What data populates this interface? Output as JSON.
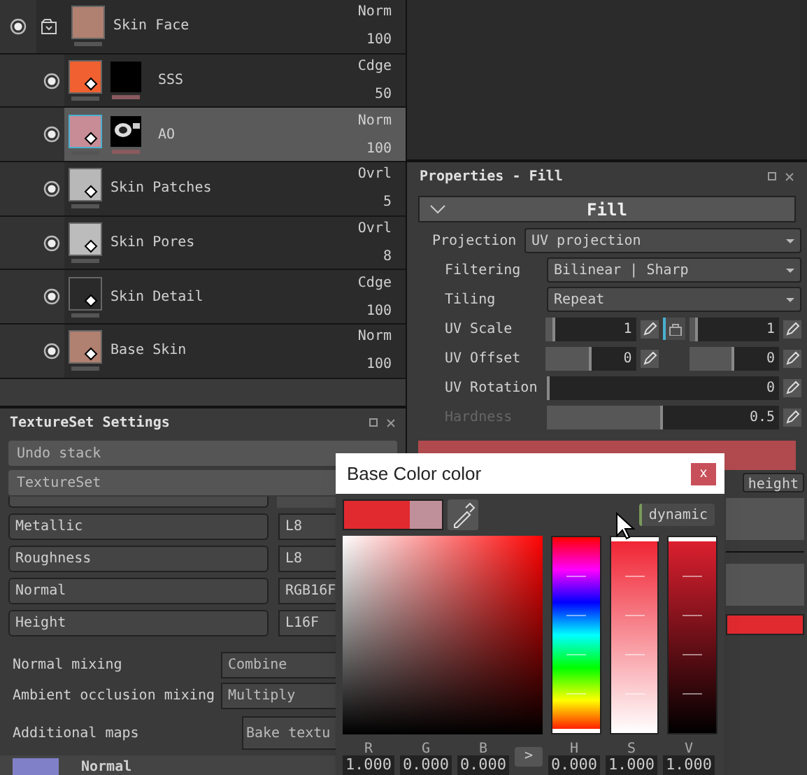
{
  "layers": [
    {
      "kind": "folder",
      "name": "Skin Face",
      "blend": "Norm",
      "opacity": "100",
      "visible": true,
      "selected": false,
      "color": "#b08070",
      "children": [
        {
          "kind": "fill",
          "name": "SSS",
          "blend": "Cdge",
          "opacity": "50",
          "visible": true,
          "selected": false,
          "color": "#f06030",
          "mask": {
            "kind": "black"
          }
        },
        {
          "kind": "fill",
          "name": "AO",
          "blend": "Norm",
          "opacity": "100",
          "visible": true,
          "selected": true,
          "color": "#c88c96",
          "mask": {
            "kind": "ao"
          }
        },
        {
          "kind": "fill",
          "name": "Skin Patches",
          "blend": "Ovrl",
          "opacity": "5",
          "visible": true,
          "selected": false,
          "color": "#b8b8b8"
        },
        {
          "kind": "fill",
          "name": "Skin Pores",
          "blend": "Ovrl",
          "opacity": "8",
          "visible": true,
          "selected": false,
          "color": "#bcbcbc"
        },
        {
          "kind": "fill",
          "name": "Skin Detail",
          "blend": "Cdge",
          "opacity": "100",
          "visible": true,
          "selected": false,
          "color": "#2a2a2a"
        },
        {
          "kind": "fill",
          "name": "Base Skin",
          "blend": "Norm",
          "opacity": "100",
          "visible": true,
          "selected": false,
          "color": "#b08070"
        }
      ]
    }
  ],
  "properties": {
    "title": "Properties - Fill",
    "section": {
      "title": "Fill",
      "expanded": true
    },
    "rows": [
      {
        "kind": "dropdown",
        "label": "Projection",
        "value": "UV projection",
        "children": [
          {
            "kind": "dropdown",
            "label": "Filtering",
            "value": "Bilinear | Sharp",
            "disabled": false
          },
          {
            "kind": "dropdown",
            "label": "Tiling",
            "value": "Repeat",
            "disabled": false
          },
          {
            "kind": "pair",
            "label": "UV Scale",
            "locked": true,
            "disabled": false,
            "fields": [
              {
                "value": "1",
                "level": 0.1
              },
              {
                "value": "1",
                "level": 0.1
              }
            ]
          },
          {
            "kind": "pair",
            "label": "UV Offset",
            "disabled": false,
            "fields": [
              {
                "value": "0",
                "level": 0.5
              },
              {
                "value": "0",
                "level": 0.5
              }
            ]
          },
          {
            "kind": "slider",
            "label": "UV Rotation",
            "value": "0",
            "level": 0,
            "disabled": false
          },
          {
            "kind": "slider",
            "label": "Hardness",
            "value": "0.5",
            "level": 0.5,
            "disabled": true
          }
        ]
      }
    ],
    "side_buttons": [
      "height"
    ]
  },
  "texture_set": {
    "title": "TextureSet Settings",
    "buttons": [
      "Undo stack",
      "TextureSet"
    ],
    "channels": [
      {
        "name": "Metallic",
        "format": "L8"
      },
      {
        "name": "Roughness",
        "format": "L8"
      },
      {
        "name": "Normal",
        "format": "RGB16F"
      },
      {
        "name": "Height",
        "format": "L16F"
      }
    ],
    "mixing": [
      {
        "label": "Normal mixing",
        "value": "Combine"
      },
      {
        "label": "Ambient occlusion mixing",
        "value": "Multiply"
      }
    ],
    "additional_maps": {
      "label": "Additional maps",
      "button": "Bake textu"
    },
    "maps": [
      {
        "name": "Normal",
        "color": "#8080c8"
      }
    ]
  },
  "color_dialog": {
    "title": "Base Color color",
    "close": "x",
    "mode_button": "dynamic",
    "channels": [
      {
        "label": "R",
        "value": "1.000"
      },
      {
        "label": "G",
        "value": "0.000"
      },
      {
        "label": "B",
        "value": "0.000"
      }
    ],
    "toggle": ">",
    "hsv": [
      {
        "label": "H",
        "value": "0.000",
        "level": 0
      },
      {
        "label": "S",
        "value": "1.000",
        "level": 1
      },
      {
        "label": "V",
        "value": "1.000",
        "level": 1
      }
    ]
  }
}
